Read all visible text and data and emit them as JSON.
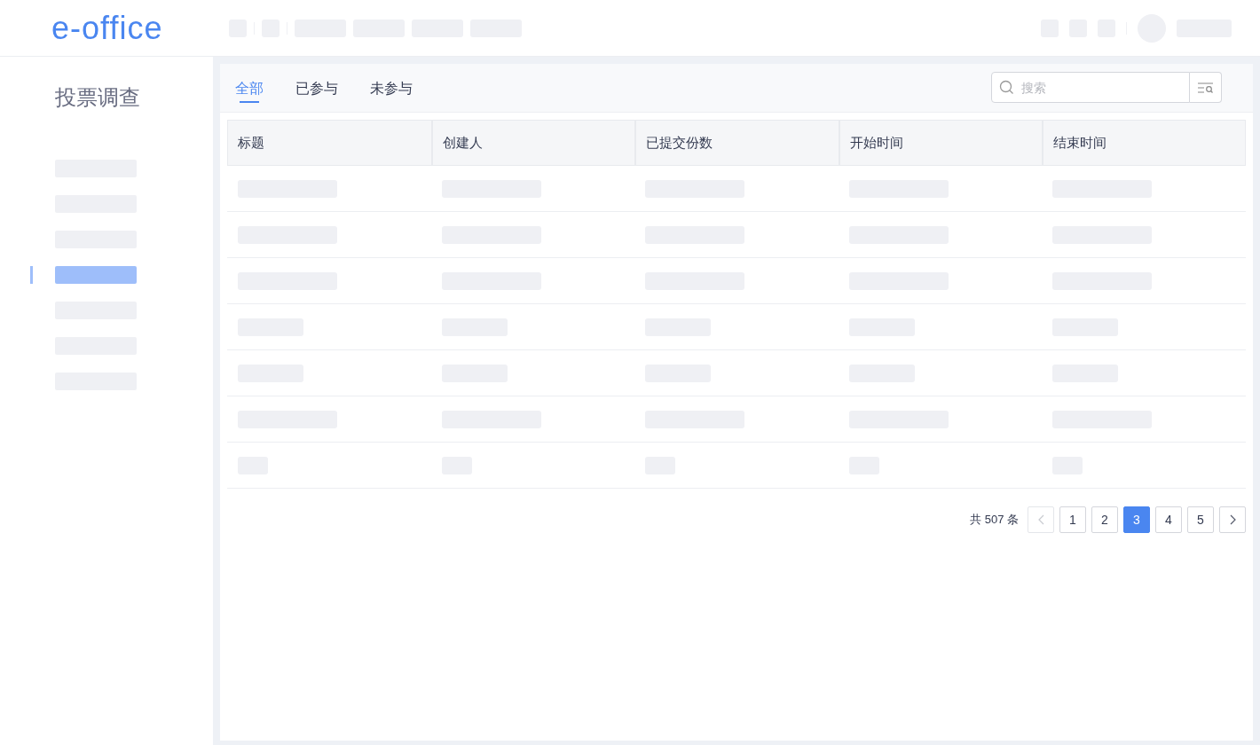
{
  "header": {
    "logo": "e-office"
  },
  "sidebar": {
    "title": "投票调查",
    "items": [
      {
        "selected": false
      },
      {
        "selected": false
      },
      {
        "selected": false
      },
      {
        "selected": true
      },
      {
        "selected": false
      },
      {
        "selected": false
      },
      {
        "selected": false
      }
    ]
  },
  "tabs": [
    {
      "label": "全部",
      "selected": true
    },
    {
      "label": "已参与",
      "selected": false
    },
    {
      "label": "未参与",
      "selected": false
    }
  ],
  "search": {
    "placeholder": "搜索"
  },
  "table": {
    "columns": [
      "标题",
      "创建人",
      "已提交份数",
      "开始时间",
      "结束时间"
    ],
    "rows": [
      {
        "kind": "long"
      },
      {
        "kind": "long"
      },
      {
        "kind": "long"
      },
      {
        "kind": "medium"
      },
      {
        "kind": "medium"
      },
      {
        "kind": "long"
      },
      {
        "kind": "short"
      }
    ]
  },
  "pagination": {
    "total": "共 507 条",
    "pages": [
      {
        "label": "1",
        "selected": false
      },
      {
        "label": "2",
        "selected": false
      },
      {
        "label": "3",
        "selected": true
      },
      {
        "label": "4",
        "selected": false
      },
      {
        "label": "5",
        "selected": false
      }
    ]
  }
}
